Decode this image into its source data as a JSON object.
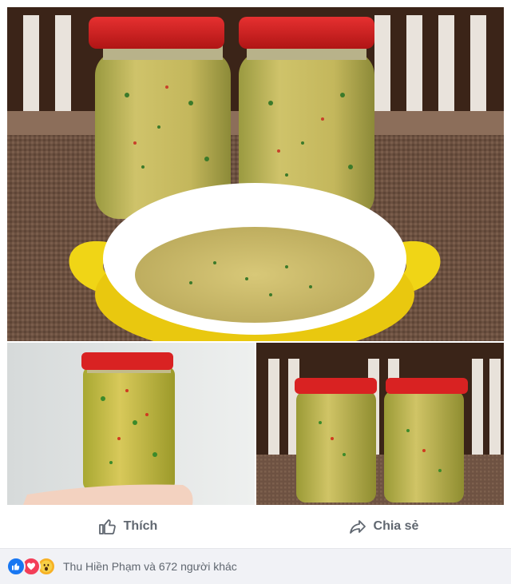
{
  "post": {
    "photos": [
      {
        "name": "main-photo",
        "subject": "two jars and bowl of sauce"
      },
      {
        "name": "photo-2",
        "subject": "single jar held in hand"
      },
      {
        "name": "photo-3",
        "subject": "two jars on table"
      }
    ]
  },
  "actions": {
    "like_label": "Thích",
    "share_label": "Chia sẻ"
  },
  "reactions": {
    "icons": [
      "like-icon",
      "love-icon",
      "wow-icon"
    ],
    "summary": "Thu Hiền Phạm và 672 người khác"
  },
  "colors": {
    "like": "#1877f2",
    "love": "#f33e58",
    "wow": "#f7b125",
    "text_gray": "#606770"
  }
}
